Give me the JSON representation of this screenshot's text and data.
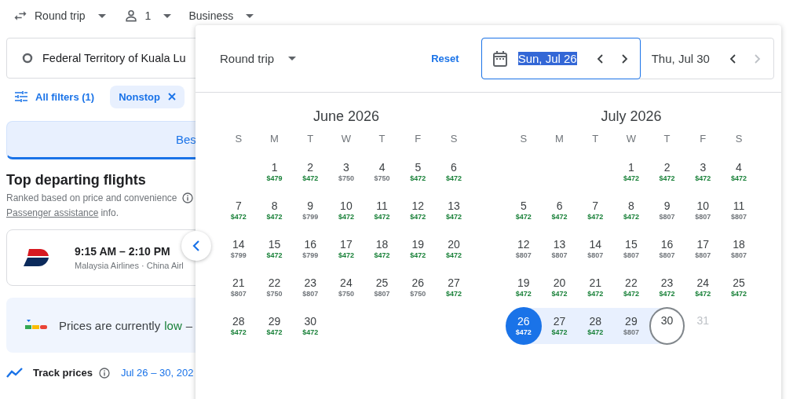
{
  "top_bar": {
    "trip_type": "Round trip",
    "passengers": "1",
    "cabin": "Business"
  },
  "search": {
    "origin": "Federal Territory of Kuala Lu"
  },
  "filters": {
    "all_filters": "All filters (1)",
    "chips": [
      {
        "label": "Nonstop"
      }
    ]
  },
  "sort_tabs": [
    {
      "label": "Bes",
      "selected": true
    }
  ],
  "results": {
    "heading": "Top departing flights",
    "subheading": "Ranked based on price and convenience",
    "assist_link": "Passenger assistance",
    "assist_tail": "info.",
    "flights": [
      {
        "times": "9:15 AM – 2:10 PM",
        "airlines": "Malaysia Airlines · China Airl"
      }
    ]
  },
  "price_insight": {
    "lead": "Prices are currently",
    "level_word": "low",
    "tail": "–"
  },
  "track": {
    "label": "Track prices",
    "dates": "Jul 26 – 30, 202"
  },
  "date_picker": {
    "trip_type": "Round trip",
    "reset": "Reset",
    "departure": {
      "value": "Sun, Jul 26",
      "focused": true,
      "text_selected": true,
      "prev_disabled": false,
      "next_disabled": false
    },
    "return": {
      "value": "Thu, Jul 30",
      "focused": false,
      "text_selected": false,
      "prev_disabled": false,
      "next_disabled": true
    },
    "months": [
      {
        "title": "June 2026",
        "weekdays": [
          "S",
          "M",
          "T",
          "W",
          "T",
          "F",
          "S"
        ],
        "weeks": [
          [
            {
              "day": "1",
              "price": "$479",
              "low": true,
              "selected": false,
              "in_range": false,
              "range_end": false,
              "disabled": false
            },
            {
              "day": "2",
              "price": "$472",
              "low": true,
              "selected": false,
              "in_range": false,
              "range_end": false,
              "disabled": false
            },
            {
              "day": "3",
              "price": "$750",
              "low": false,
              "selected": false,
              "in_range": false,
              "range_end": false,
              "disabled": false
            },
            {
              "day": "4",
              "price": "$750",
              "low": false,
              "selected": false,
              "in_range": false,
              "range_end": false,
              "disabled": false
            },
            {
              "day": "5",
              "price": "$472",
              "low": true,
              "selected": false,
              "in_range": false,
              "range_end": false,
              "disabled": false
            },
            {
              "day": "6",
              "price": "$472",
              "low": true,
              "selected": false,
              "in_range": false,
              "range_end": false,
              "disabled": false
            }
          ],
          [
            {
              "day": "7",
              "price": "$472",
              "low": true,
              "selected": false,
              "in_range": false,
              "range_end": false,
              "disabled": false
            },
            {
              "day": "8",
              "price": "$472",
              "low": true,
              "selected": false,
              "in_range": false,
              "range_end": false,
              "disabled": false
            },
            {
              "day": "9",
              "price": "$799",
              "low": false,
              "selected": false,
              "in_range": false,
              "range_end": false,
              "disabled": false
            },
            {
              "day": "10",
              "price": "$472",
              "low": true,
              "selected": false,
              "in_range": false,
              "range_end": false,
              "disabled": false
            },
            {
              "day": "11",
              "price": "$472",
              "low": true,
              "selected": false,
              "in_range": false,
              "range_end": false,
              "disabled": false
            },
            {
              "day": "12",
              "price": "$472",
              "low": true,
              "selected": false,
              "in_range": false,
              "range_end": false,
              "disabled": false
            },
            {
              "day": "13",
              "price": "$472",
              "low": true,
              "selected": false,
              "in_range": false,
              "range_end": false,
              "disabled": false
            }
          ],
          [
            {
              "day": "14",
              "price": "$799",
              "low": false,
              "selected": false,
              "in_range": false,
              "range_end": false,
              "disabled": false
            },
            {
              "day": "15",
              "price": "$472",
              "low": true,
              "selected": false,
              "in_range": false,
              "range_end": false,
              "disabled": false
            },
            {
              "day": "16",
              "price": "$799",
              "low": false,
              "selected": false,
              "in_range": false,
              "range_end": false,
              "disabled": false
            },
            {
              "day": "17",
              "price": "$472",
              "low": true,
              "selected": false,
              "in_range": false,
              "range_end": false,
              "disabled": false
            },
            {
              "day": "18",
              "price": "$472",
              "low": true,
              "selected": false,
              "in_range": false,
              "range_end": false,
              "disabled": false
            },
            {
              "day": "19",
              "price": "$472",
              "low": true,
              "selected": false,
              "in_range": false,
              "range_end": false,
              "disabled": false
            },
            {
              "day": "20",
              "price": "$472",
              "low": true,
              "selected": false,
              "in_range": false,
              "range_end": false,
              "disabled": false
            }
          ],
          [
            {
              "day": "21",
              "price": "$807",
              "low": false,
              "selected": false,
              "in_range": false,
              "range_end": false,
              "disabled": false
            },
            {
              "day": "22",
              "price": "$750",
              "low": false,
              "selected": false,
              "in_range": false,
              "range_end": false,
              "disabled": false
            },
            {
              "day": "23",
              "price": "$807",
              "low": false,
              "selected": false,
              "in_range": false,
              "range_end": false,
              "disabled": false
            },
            {
              "day": "24",
              "price": "$750",
              "low": false,
              "selected": false,
              "in_range": false,
              "range_end": false,
              "disabled": false
            },
            {
              "day": "25",
              "price": "$807",
              "low": false,
              "selected": false,
              "in_range": false,
              "range_end": false,
              "disabled": false
            },
            {
              "day": "26",
              "price": "$750",
              "low": false,
              "selected": false,
              "in_range": false,
              "range_end": false,
              "disabled": false
            },
            {
              "day": "27",
              "price": "$472",
              "low": true,
              "selected": false,
              "in_range": false,
              "range_end": false,
              "disabled": false
            }
          ],
          [
            {
              "day": "28",
              "price": "$472",
              "low": true,
              "selected": false,
              "in_range": false,
              "range_end": false,
              "disabled": false
            },
            {
              "day": "29",
              "price": "$472",
              "low": true,
              "selected": false,
              "in_range": false,
              "range_end": false,
              "disabled": false
            },
            {
              "day": "30",
              "price": "$472",
              "low": true,
              "selected": false,
              "in_range": false,
              "range_end": false,
              "disabled": false
            }
          ]
        ]
      },
      {
        "title": "July 2026",
        "weekdays": [
          "S",
          "M",
          "T",
          "W",
          "T",
          "F",
          "S"
        ],
        "weeks": [
          [
            {
              "day": "1",
              "price": "$472",
              "low": true,
              "selected": false,
              "in_range": false,
              "range_end": false,
              "disabled": false
            },
            {
              "day": "2",
              "price": "$472",
              "low": true,
              "selected": false,
              "in_range": false,
              "range_end": false,
              "disabled": false
            },
            {
              "day": "3",
              "price": "$472",
              "low": true,
              "selected": false,
              "in_range": false,
              "range_end": false,
              "disabled": false
            },
            {
              "day": "4",
              "price": "$472",
              "low": true,
              "selected": false,
              "in_range": false,
              "range_end": false,
              "disabled": false
            }
          ],
          [
            {
              "day": "5",
              "price": "$472",
              "low": true,
              "selected": false,
              "in_range": false,
              "range_end": false,
              "disabled": false
            },
            {
              "day": "6",
              "price": "$472",
              "low": true,
              "selected": false,
              "in_range": false,
              "range_end": false,
              "disabled": false
            },
            {
              "day": "7",
              "price": "$472",
              "low": true,
              "selected": false,
              "in_range": false,
              "range_end": false,
              "disabled": false
            },
            {
              "day": "8",
              "price": "$472",
              "low": true,
              "selected": false,
              "in_range": false,
              "range_end": false,
              "disabled": false
            },
            {
              "day": "9",
              "price": "$807",
              "low": false,
              "selected": false,
              "in_range": false,
              "range_end": false,
              "disabled": false
            },
            {
              "day": "10",
              "price": "$807",
              "low": false,
              "selected": false,
              "in_range": false,
              "range_end": false,
              "disabled": false
            },
            {
              "day": "11",
              "price": "$807",
              "low": false,
              "selected": false,
              "in_range": false,
              "range_end": false,
              "disabled": false
            }
          ],
          [
            {
              "day": "12",
              "price": "$807",
              "low": false,
              "selected": false,
              "in_range": false,
              "range_end": false,
              "disabled": false
            },
            {
              "day": "13",
              "price": "$807",
              "low": false,
              "selected": false,
              "in_range": false,
              "range_end": false,
              "disabled": false
            },
            {
              "day": "14",
              "price": "$807",
              "low": false,
              "selected": false,
              "in_range": false,
              "range_end": false,
              "disabled": false
            },
            {
              "day": "15",
              "price": "$807",
              "low": false,
              "selected": false,
              "in_range": false,
              "range_end": false,
              "disabled": false
            },
            {
              "day": "16",
              "price": "$807",
              "low": false,
              "selected": false,
              "in_range": false,
              "range_end": false,
              "disabled": false
            },
            {
              "day": "17",
              "price": "$807",
              "low": false,
              "selected": false,
              "in_range": false,
              "range_end": false,
              "disabled": false
            },
            {
              "day": "18",
              "price": "$807",
              "low": false,
              "selected": false,
              "in_range": false,
              "range_end": false,
              "disabled": false
            }
          ],
          [
            {
              "day": "19",
              "price": "$472",
              "low": true,
              "selected": false,
              "in_range": false,
              "range_end": false,
              "disabled": false
            },
            {
              "day": "20",
              "price": "$472",
              "low": true,
              "selected": false,
              "in_range": false,
              "range_end": false,
              "disabled": false
            },
            {
              "day": "21",
              "price": "$472",
              "low": true,
              "selected": false,
              "in_range": false,
              "range_end": false,
              "disabled": false
            },
            {
              "day": "22",
              "price": "$472",
              "low": true,
              "selected": false,
              "in_range": false,
              "range_end": false,
              "disabled": false
            },
            {
              "day": "23",
              "price": "$472",
              "low": true,
              "selected": false,
              "in_range": false,
              "range_end": false,
              "disabled": false
            },
            {
              "day": "24",
              "price": "$472",
              "low": true,
              "selected": false,
              "in_range": false,
              "range_end": false,
              "disabled": false
            },
            {
              "day": "25",
              "price": "$472",
              "low": true,
              "selected": false,
              "in_range": false,
              "range_end": false,
              "disabled": false
            }
          ],
          [
            {
              "day": "26",
              "price": "$472",
              "selected": true,
              "in_range": false,
              "range_end": false,
              "disabled": false
            },
            {
              "day": "27",
              "price": "$472",
              "low": true,
              "selected": false,
              "in_range": true,
              "range_end": false,
              "disabled": false
            },
            {
              "day": "28",
              "price": "$472",
              "low": true,
              "selected": false,
              "in_range": true,
              "range_end": false,
              "disabled": false
            },
            {
              "day": "29",
              "price": "$807",
              "low": false,
              "selected": false,
              "in_range": true,
              "range_end": false,
              "disabled": false
            },
            {
              "day": "30",
              "selected": false,
              "in_range": false,
              "range_end": true,
              "disabled": false
            },
            {
              "day": "31",
              "selected": false,
              "in_range": false,
              "range_end": false,
              "disabled": true
            }
          ]
        ]
      }
    ]
  }
}
